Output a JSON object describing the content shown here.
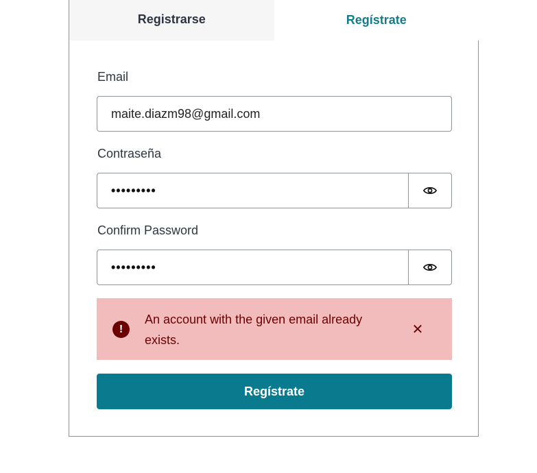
{
  "tabs": {
    "login_label": "Registrarse",
    "signup_label": "Regístrate"
  },
  "form": {
    "email_label": "Email",
    "email_value": "maite.diazm98@gmail.com",
    "password_label": "Contraseña",
    "password_mask": "•••••••••",
    "confirm_label": "Confirm Password",
    "confirm_mask": "•••••••••"
  },
  "alert": {
    "message": "An account with the given email already exists.",
    "icon": "exclamation-icon",
    "close_icon": "close-icon",
    "background_color": "#f2bcbc",
    "text_color": "#6b0000"
  },
  "submit": {
    "label": "Regístrate",
    "color": "#0a7b8f"
  },
  "colors": {
    "active_tab": "#137e8a",
    "inactive_tab_bg": "#f6f6f6"
  }
}
